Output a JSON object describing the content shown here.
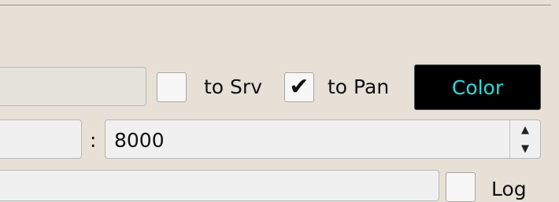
{
  "toolbar": {
    "to_srv_checkbox": {
      "label": "to Srv",
      "checked": false
    },
    "to_pan_checkbox": {
      "label": "to Pan",
      "checked": true,
      "check_glyph": "✔"
    },
    "color_button": {
      "label": "Color",
      "background": "#000000",
      "text_color": "#2ad9dc"
    }
  },
  "connection": {
    "separator": ":",
    "port_value": "8000",
    "spin_up_glyph": "▲",
    "spin_down_glyph": "▼"
  },
  "log_checkbox": {
    "label": "Log",
    "checked": false
  }
}
